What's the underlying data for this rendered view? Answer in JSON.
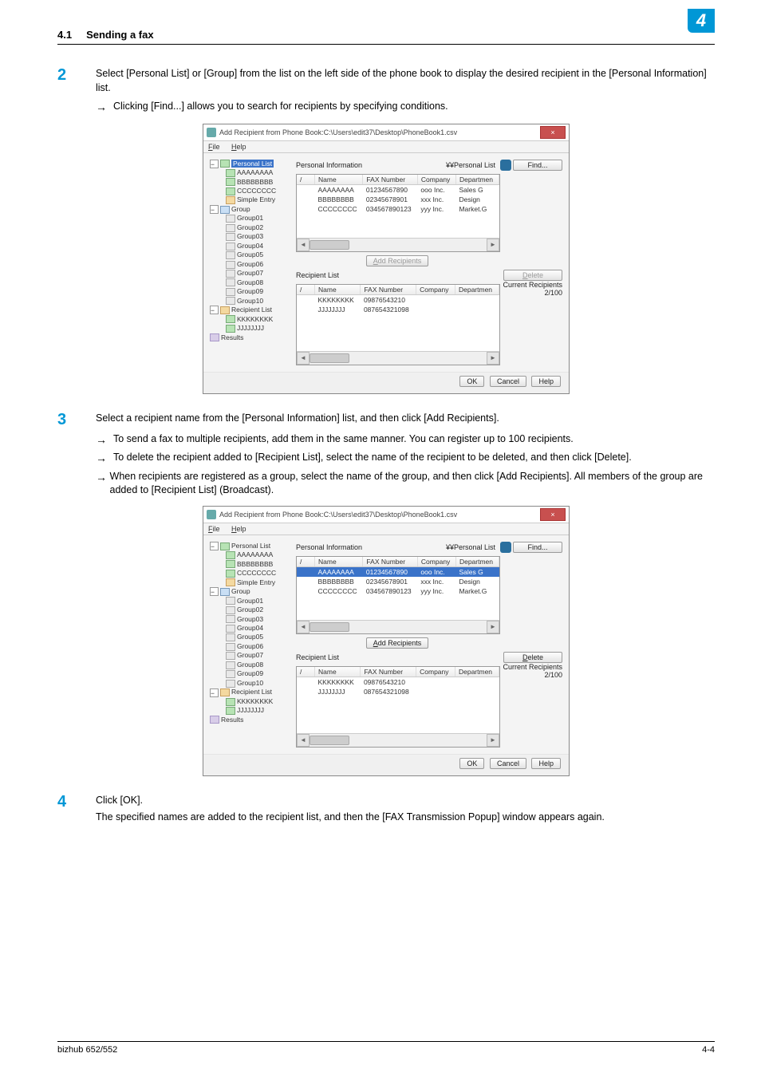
{
  "header": {
    "section": "4.1",
    "title": "Sending a fax",
    "chapter": "4"
  },
  "footer": {
    "model": "bizhub 652/552",
    "page": "4-4"
  },
  "steps": {
    "s2": {
      "num": "2",
      "text": "Select [Personal List] or [Group] from the list on the left side of the phone book to display the desired recipient in the [Personal Information] list.",
      "sub1": "Clicking [Find...] allows you to search for recipients by specifying conditions."
    },
    "s3": {
      "num": "3",
      "text": "Select a recipient name from the [Personal Information] list, and then click [Add Recipients].",
      "sub1": "To send a fax to multiple recipients, add them in the same manner. You can register up to 100 recipients.",
      "sub2": "To delete the recipient added to [Recipient List], select the name of the recipient to be deleted, and then click [Delete].",
      "sub3": "When recipients are registered as a group, select the name of the group, and then click [Add Recipients]. All members of the group are added to [Recipient List] (Broadcast)."
    },
    "s4": {
      "num": "4",
      "text": "Click [OK].",
      "text2": "The specified names are added to the recipient list, and then the [FAX Transmission Popup] window appears again."
    }
  },
  "arrow": "→",
  "dialog": {
    "title": "Add Recipient from Phone Book:C:\\Users\\edit37\\Desktop\\PhoneBook1.csv",
    "close_x": "×",
    "menu_file": "File",
    "menu_help": "Help",
    "tree": {
      "personal_list": "Personal List",
      "aaa": "AAAAAAAA",
      "bbb": "BBBBBBBB",
      "ccc": "CCCCCCCC",
      "simple": "Simple Entry",
      "group": "Group",
      "g": [
        "Group01",
        "Group02",
        "Group03",
        "Group04",
        "Group05",
        "Group06",
        "Group07",
        "Group08",
        "Group09",
        "Group10"
      ],
      "recipient_list": "Recipient List",
      "kkk": "KKKKKKKK",
      "jjj": "JJJJJJJJ",
      "results": "Results"
    },
    "labels": {
      "personal_info": "Personal Information",
      "personal_count": "¥¥Personal List",
      "recipient_list": "Recipient List",
      "current_recipients": "Current Recipients",
      "count": "2/100"
    },
    "buttons": {
      "find": "Find...",
      "add": "Add Recipients",
      "delete": "Delete",
      "ok": "OK",
      "cancel": "Cancel",
      "help": "Help"
    },
    "cols": {
      "c0": "/",
      "name": "Name",
      "fax": "FAX Number",
      "company": "Company",
      "dept": "Departmen"
    },
    "pi_rows": [
      {
        "name": "AAAAAAAA",
        "fax": "01234567890",
        "company": "ooo Inc.",
        "dept": "Sales G"
      },
      {
        "name": "BBBBBBBB",
        "fax": "02345678901",
        "company": "xxx Inc.",
        "dept": "Design"
      },
      {
        "name": "CCCCCCCC",
        "fax": "034567890123",
        "company": "yyy Inc.",
        "dept": "Market.G"
      }
    ],
    "rl_rows": [
      {
        "name": "KKKKKKKK",
        "fax": "09876543210",
        "company": "",
        "dept": ""
      },
      {
        "name": "JJJJJJJJ",
        "fax": "087654321098",
        "company": "",
        "dept": ""
      }
    ]
  }
}
